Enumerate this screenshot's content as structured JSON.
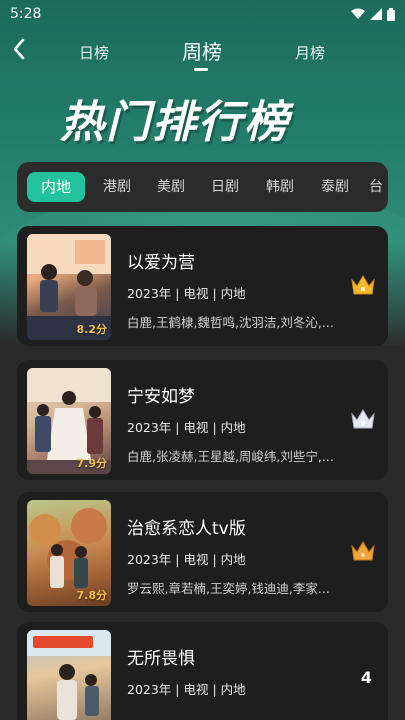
{
  "status": {
    "time": "5:28"
  },
  "nav": {
    "tabs": [
      {
        "label": "日榜",
        "active": false
      },
      {
        "label": "周榜",
        "active": true
      },
      {
        "label": "月榜",
        "active": false
      }
    ]
  },
  "hero": {
    "title": "热门排行榜"
  },
  "regions": [
    {
      "label": "内地",
      "active": true
    },
    {
      "label": "港剧",
      "active": false
    },
    {
      "label": "美剧",
      "active": false
    },
    {
      "label": "日剧",
      "active": false
    },
    {
      "label": "韩剧",
      "active": false
    },
    {
      "label": "泰剧",
      "active": false
    },
    {
      "label": "台",
      "active": false
    }
  ],
  "list": [
    {
      "rank": 1,
      "rank_badge": "gold-crown-icon",
      "title": "以爱为营",
      "meta": "2023年 | 电视 | 内地",
      "cast": "白鹿,王鹤棣,魏哲鸣,沈羽洁,刘冬沁,...",
      "score": "8.2分"
    },
    {
      "rank": 2,
      "rank_badge": "silver-crown-icon",
      "title": "宁安如梦",
      "meta": "2023年 | 电视 | 内地",
      "cast": "白鹿,张凌赫,王星越,周峻纬,刘些宁,...",
      "score": "7.9分"
    },
    {
      "rank": 3,
      "rank_badge": "bronze-crown-icon",
      "title": "治愈系恋人tv版",
      "meta": "2023年 | 电视 | 内地",
      "cast": "罗云熙,章若楠,王奕婷,钱迪迪,李家...",
      "score": "7.8分"
    },
    {
      "rank": "4",
      "rank_badge": "",
      "title": "无所畏惧",
      "meta": "2023年 | 电视 | 内地",
      "cast": "",
      "score": ""
    }
  ],
  "colors": {
    "accent": "#23c29d",
    "gold": "#f5b82e",
    "silver": "#e6e9f2",
    "bronze": "#f0a43a"
  }
}
